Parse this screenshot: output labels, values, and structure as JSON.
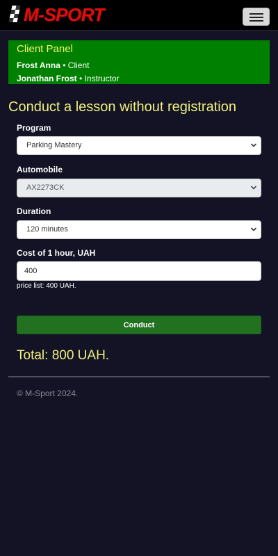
{
  "brand": {
    "name": "M-SPORT",
    "logo_icon": "checkered-flag-icon",
    "color": "#e10d0d"
  },
  "nav": {
    "menu_icon": "hamburger-menu-icon"
  },
  "panel": {
    "title": "Client Panel",
    "client_name": "Frost Anna",
    "client_role": "Client",
    "instructor_name": "Jonathan Frost",
    "instructor_role": "Instructor",
    "separator": "•",
    "background": "#008000"
  },
  "page": {
    "title": "Conduct a lesson without registration"
  },
  "form": {
    "program_label": "Program",
    "program_value": "Parking Mastery",
    "automobile_label": "Automobile",
    "automobile_value": "AX2273CK",
    "duration_label": "Duration",
    "duration_value": "120 minutes",
    "cost_label": "Cost of 1 hour, UAH",
    "cost_value": "400",
    "price_hint": "price list: 400 UAH.",
    "submit_label": "Conduct"
  },
  "summary": {
    "total": "Total: 800 UAH."
  },
  "footer": {
    "copyright": "© M-Sport 2024."
  }
}
